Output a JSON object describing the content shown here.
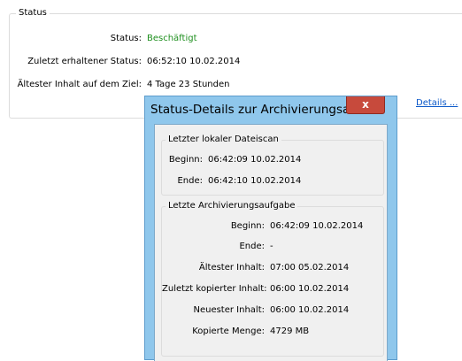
{
  "status_panel": {
    "legend": "Status",
    "rows": [
      {
        "label": "Status:",
        "value": "Beschäftigt"
      },
      {
        "label": "Zuletzt erhaltener Status:",
        "value": "06:52:10 10.02.2014"
      },
      {
        "label": "Ältester Inhalt auf dem Ziel:",
        "value": "4 Tage 23 Stunden"
      }
    ],
    "details_link": "Details ...",
    "status_color": "#1e8f1e"
  },
  "dialog": {
    "title": "Status-Details zur Archivierungsa...",
    "close_glyph": "x",
    "scan_group": {
      "legend": "Letzter lokaler Dateiscan",
      "rows": [
        {
          "label": "Beginn:",
          "value": "06:42:09 10.02.2014"
        },
        {
          "label": "Ende:",
          "value": "06:42:10 10.02.2014"
        }
      ]
    },
    "task_group": {
      "legend": "Letzte Archivierungsaufgabe",
      "rows": [
        {
          "label": "Beginn:",
          "value": "06:42:09 10.02.2014"
        },
        {
          "label": "Ende:",
          "value": "-"
        },
        {
          "label": "Ältester Inhalt:",
          "value": "07:00 05.02.2014"
        },
        {
          "label": "Zuletzt kopierter Inhalt:",
          "value": "06:00 10.02.2014"
        },
        {
          "label": "Neuester Inhalt:",
          "value": "06:00 10.02.2014"
        },
        {
          "label": "Kopierte Menge:",
          "value": "4729 MB"
        }
      ]
    }
  }
}
